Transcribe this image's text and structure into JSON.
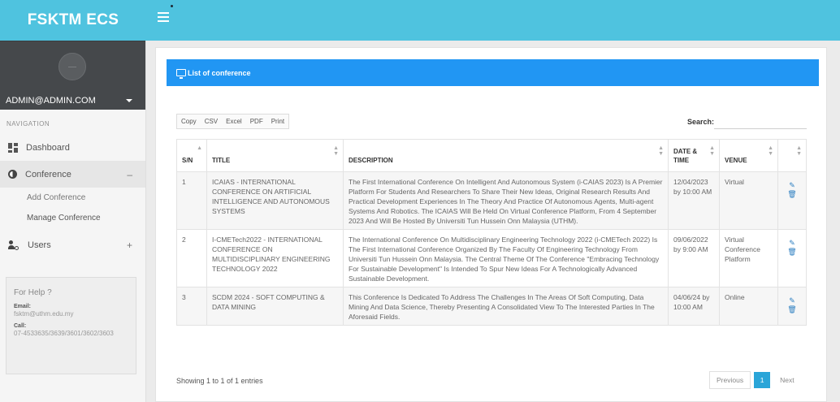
{
  "app": {
    "brand": "FSKTM ECS"
  },
  "sidebar": {
    "user": "ADMIN@ADMIN.COM",
    "nav_heading": "NAVIGATION",
    "items": [
      {
        "label": "Dashboard",
        "icon": "dashboard-icon"
      },
      {
        "label": "Conference",
        "icon": "half-circle-icon",
        "toggle": "–"
      },
      {
        "label": "Users",
        "icon": "users-settings-icon",
        "toggle": "+"
      }
    ],
    "subitems": [
      "Add Conference",
      "Manage Conference"
    ],
    "help": {
      "title": "For Help ?",
      "email_label": "Email:",
      "email": "fsktm@uthm.edu.my",
      "call_label": "Call:",
      "call": "07-4533635/3639/3601/3602/3603"
    }
  },
  "card": {
    "title": "List of conference",
    "buttons": [
      "Copy",
      "CSV",
      "Excel",
      "PDF",
      "Print"
    ],
    "search_label": "Search:",
    "columns": [
      "S/N",
      "TITLE",
      "DESCRIPTION",
      "DATE & TIME",
      "VENUE",
      ""
    ],
    "rows": [
      {
        "sn": "1",
        "title": "ICAIAS - INTERNATIONAL CONFERENCE ON ARTIFICIAL INTELLIGENCE AND AUTONOMOUS SYSTEMS",
        "description": "The First International Conference On Intelligent And Autonomous System (i-CAIAS 2023) Is A Premier Platform For Students And Researchers To Share Their New Ideas, Original Research Results And Practical Development Experiences In The Theory And Practice Of Autonomous Agents, Multi-agent Systems And Robotics. The ICAIAS Will Be Held On Virtual Conference Platform, From 4 September 2023 And Will Be Hosted By Universiti Tun Hussein Onn Malaysia (UTHM).",
        "datetime": "12/04/2023 by 10:00 AM",
        "venue": "Virtual"
      },
      {
        "sn": "2",
        "title": "I-CMETech2022 - INTERNATIONAL CONFERENCE ON MULTIDISCIPLINARY ENGINEERING TECHNOLOGY 2022",
        "description": "The International Conference On Multidisciplinary Engineering Technology 2022 (i-CMETech 2022) Is The First International Conference Organized By The Faculty Of Engineering Technology From Universiti Tun Hussein Onn Malaysia. The Central Theme Of The Conference \"Embracing Technology For Sustainable Development\" Is Intended To Spur New Ideas For A Technologically Advanced Sustainable Development.",
        "datetime": "09/06/2022 by 9:00 AM",
        "venue": "Virtual Conference Platform"
      },
      {
        "sn": "3",
        "title": "SCDM 2024 - SOFT COMPUTING & DATA MINING",
        "description": "This Conference Is Dedicated To Address The Challenges In The Areas Of Soft Computing, Data Mining And Data Science, Thereby Presenting A Consolidated View To The Interested Parties In The Aforesaid Fields.",
        "datetime": "04/06/24 by 10:00 AM",
        "venue": "Online"
      }
    ],
    "footer_info": "Showing 1 to 1 of 1 entries",
    "pager": {
      "prev": "Previous",
      "current": "1",
      "next": "Next"
    }
  },
  "colors": {
    "topbar": "#4fc3df",
    "header": "#2196f3",
    "profile": "#45484b",
    "active_page": "#2aa5d8"
  }
}
